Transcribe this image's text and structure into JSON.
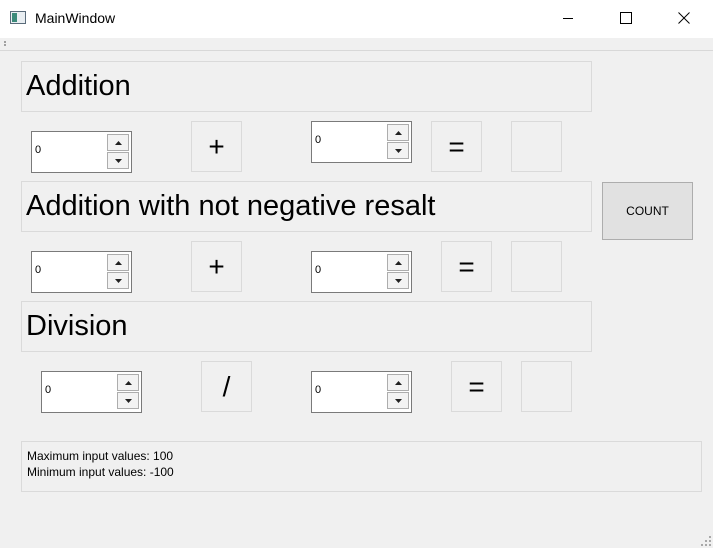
{
  "window": {
    "title": "MainWindow"
  },
  "sections": {
    "addition": {
      "label": "Addition",
      "operand1": "0",
      "operator": "+",
      "operand2": "0",
      "equals": "=",
      "result": ""
    },
    "addition_nonneg": {
      "label": "Addition with not negative resalt",
      "operand1": "0",
      "operator": "+",
      "operand2": "0",
      "equals": "=",
      "result": ""
    },
    "division": {
      "label": "Division",
      "operand1": "0",
      "operator": "/",
      "operand2": "0",
      "equals": "=",
      "result": ""
    }
  },
  "count_button": {
    "label": "COUNT"
  },
  "info": {
    "line1": "Maximum input values: 100",
    "line2": "Minimum input values: -100"
  },
  "icons": {
    "app": "window-app-icon",
    "minimize": "minimize-icon",
    "maximize": "maximize-icon",
    "close": "close-icon",
    "spin_up": "chevron-up-icon",
    "spin_down": "chevron-down-icon"
  }
}
